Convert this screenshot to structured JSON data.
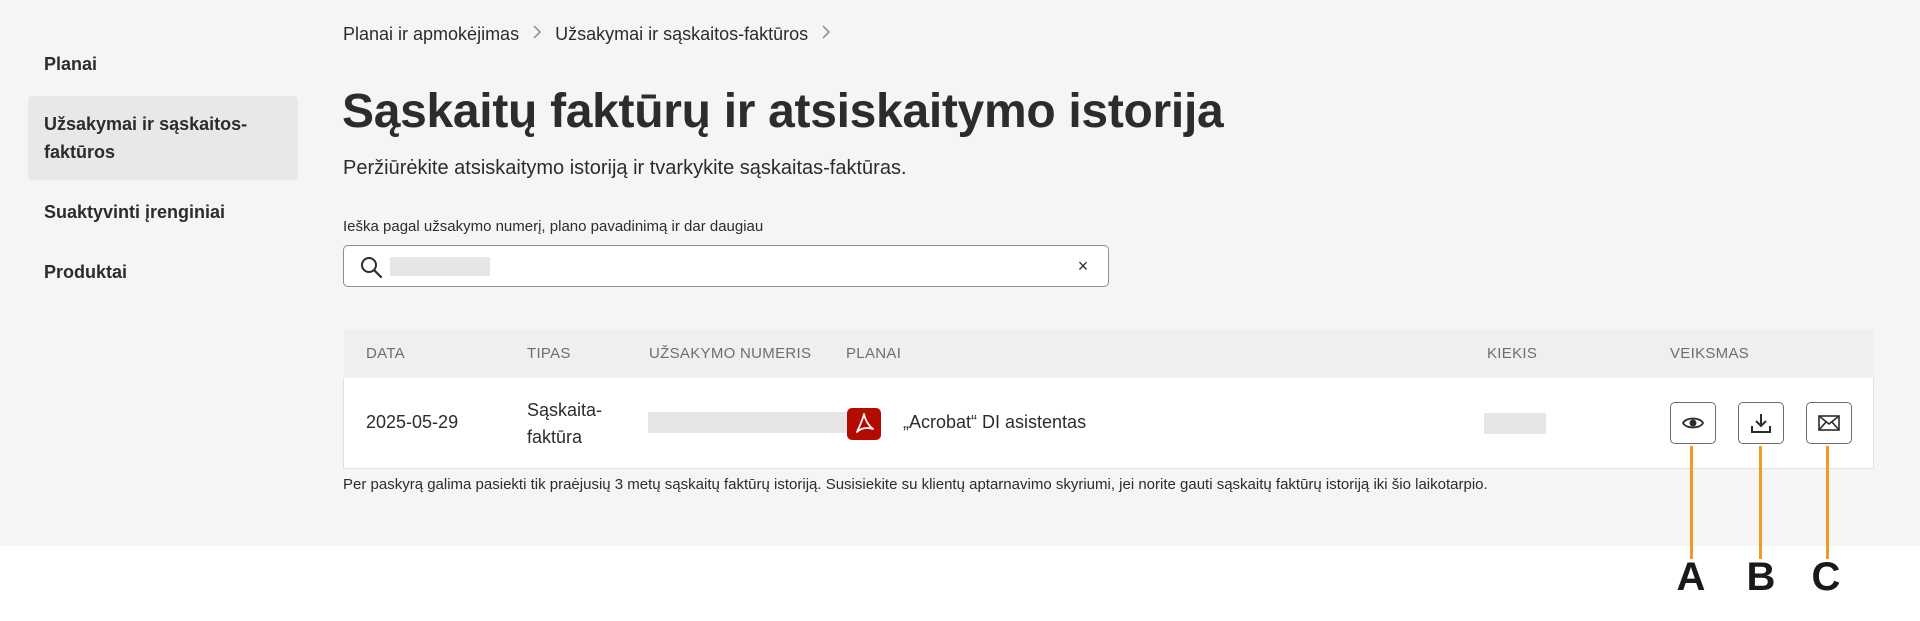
{
  "sidebar": {
    "items": [
      {
        "label": "Planai"
      },
      {
        "label": "Užsakymai ir sąskaitos-faktūros"
      },
      {
        "label": "Suaktyvinti įrenginiai"
      },
      {
        "label": "Produktai"
      }
    ]
  },
  "breadcrumb": {
    "items": [
      "Planai ir apmokėjimas",
      "Užsakymai ir sąskaitos-faktūros"
    ],
    "separator": ">"
  },
  "page": {
    "title": "Sąskaitų faktūrų ir atsiskaitymo istorija",
    "subtitle": "Peržiūrėkite atsiskaitymo istoriją ir tvarkykite sąskaitas-faktūras."
  },
  "search": {
    "label": "Ieška pagal užsakymo numerį, plano pavadinimą ir dar daugiau",
    "clear_symbol": "×"
  },
  "table": {
    "columns": [
      "DATA",
      "TIPAS",
      "UŽSAKYMO NUMERIS",
      "PLANAI",
      "KIEKIS",
      "VEIKSMAS"
    ],
    "rows": [
      {
        "date": "2025-05-29",
        "type_line1": "Sąskaita-",
        "type_line2": "faktūra",
        "plan": "„Acrobat“ DI asistentas"
      }
    ],
    "actions": [
      {
        "icon": "eye-icon",
        "callout": "A"
      },
      {
        "icon": "download-icon",
        "callout": "B"
      },
      {
        "icon": "mail-icon",
        "callout": "C"
      }
    ]
  },
  "footnote": "Per paskyrą galima pasiekti tik praėjusių 3 metų sąskaitų faktūrų istoriją. Susisiekite su klientų aptarnavimo skyriumi, jei norite gauti sąskaitų faktūrų istoriją iki šio laikotarpio.",
  "colors": {
    "callout_line": "#f29a24",
    "pdf_brand": "#b30b00",
    "panel_bg": "#f5f5f5"
  }
}
